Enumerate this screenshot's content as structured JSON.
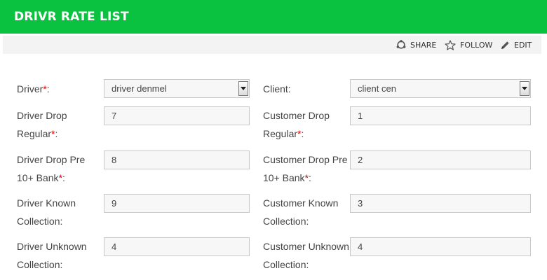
{
  "header": {
    "title": "DRIVR RATE LIST",
    "color": "#0ac23f"
  },
  "actions": [
    {
      "label": "SHARE",
      "icon": "share-icon"
    },
    {
      "label": "FOLLOW",
      "icon": "star-icon"
    },
    {
      "label": "EDIT",
      "icon": "pencil-icon"
    }
  ],
  "required_marker": "*",
  "form": {
    "driver": {
      "label": "Driver",
      "suffix": ":",
      "value": "driver denmel"
    },
    "client": {
      "label": "Client:",
      "value": "client cen"
    },
    "driver_drop_regular": {
      "line1": "Driver Drop",
      "line2": "Regular",
      "suffix": ":",
      "value": "7"
    },
    "customer_drop_regular": {
      "line1": "Customer Drop",
      "line2": "Regular",
      "suffix": ":",
      "value": "1"
    },
    "driver_drop_pre": {
      "line1": "Driver Drop Pre",
      "line2": "10+ Bank",
      "suffix": ":",
      "value": "8"
    },
    "customer_drop_pre": {
      "line1": "Customer Drop Pre",
      "line2": "10+ Bank",
      "suffix": ":",
      "value": "2"
    },
    "driver_known": {
      "line1": "Driver Known",
      "line2": "Collection:",
      "value": "9"
    },
    "customer_known": {
      "line1": "Customer Known",
      "line2": "Collection:",
      "value": "3"
    },
    "driver_unknown": {
      "line1": "Driver Unknown",
      "line2": "Collection:",
      "value": "4"
    },
    "customer_unknown": {
      "line1": "Customer Unknown",
      "line2": "Collection:",
      "value": "4"
    }
  }
}
